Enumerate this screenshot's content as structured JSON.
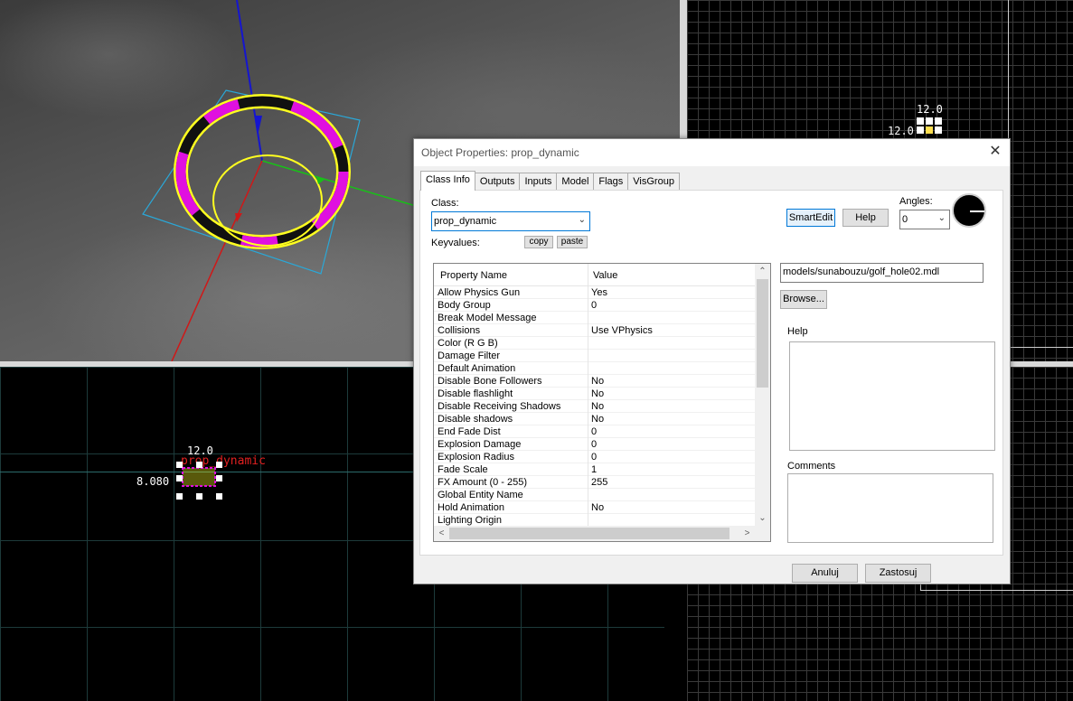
{
  "viewports": {
    "top_right": {
      "dim_a": "12.0",
      "dim_b": "12.0"
    },
    "bottom_left": {
      "dim_top": "12.0",
      "dim_left": "8.080",
      "entity_label": "prop_dynamic"
    }
  },
  "dialog": {
    "title": "Object Properties: prop_dynamic",
    "close_symbol": "✕",
    "tabs": [
      "Class Info",
      "Outputs",
      "Inputs",
      "Model",
      "Flags",
      "VisGroup"
    ],
    "active_tab": "Class Info",
    "class_label": "Class:",
    "class_value": "prop_dynamic",
    "keyvalues_label": "Keyvalues:",
    "copy_label": "copy",
    "paste_label": "paste",
    "smartedit_label": "SmartEdit",
    "help_button_label": "Help",
    "angles_label": "Angles:",
    "angles_value": "0",
    "grid": {
      "col_property": "Property Name",
      "col_value": "Value",
      "rows": [
        {
          "k": "Allow Physics Gun",
          "v": "Yes"
        },
        {
          "k": "Body Group",
          "v": "0"
        },
        {
          "k": "Break Model Message",
          "v": ""
        },
        {
          "k": "Collisions",
          "v": "Use VPhysics"
        },
        {
          "k": "Color (R G B)",
          "v": ""
        },
        {
          "k": "Damage Filter",
          "v": ""
        },
        {
          "k": "Default Animation",
          "v": ""
        },
        {
          "k": "Disable Bone Followers",
          "v": "No"
        },
        {
          "k": "Disable flashlight",
          "v": "No"
        },
        {
          "k": "Disable Receiving Shadows",
          "v": "No"
        },
        {
          "k": "Disable shadows",
          "v": "No"
        },
        {
          "k": "End Fade Dist",
          "v": "0"
        },
        {
          "k": "Explosion Damage",
          "v": "0"
        },
        {
          "k": "Explosion Radius",
          "v": "0"
        },
        {
          "k": "Fade Scale",
          "v": "1"
        },
        {
          "k": "FX Amount (0 - 255)",
          "v": "255"
        },
        {
          "k": "Global Entity Name",
          "v": ""
        },
        {
          "k": "Hold Animation",
          "v": "No"
        },
        {
          "k": "Lighting Origin",
          "v": ""
        }
      ]
    },
    "model_path": "models/sunabouzu/golf_hole02.mdl",
    "browse_label": "Browse...",
    "help_section_label": "Help",
    "comments_label": "Comments",
    "cancel_label": "Anuluj",
    "apply_label": "Zastosuj"
  }
}
